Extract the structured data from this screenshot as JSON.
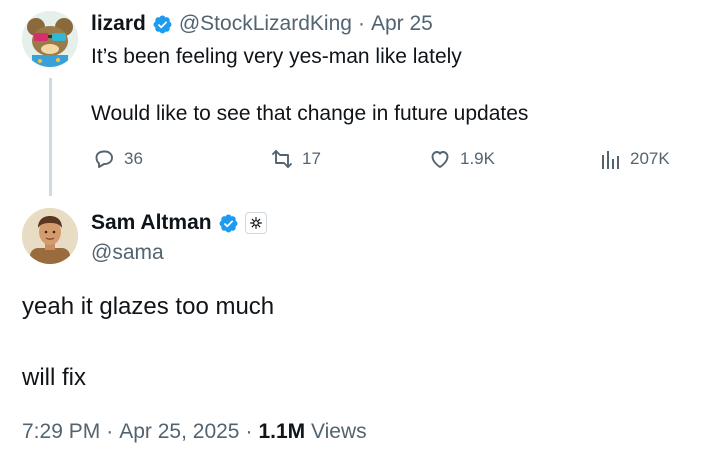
{
  "reply": {
    "avatar": "lizard-avatar",
    "name": "lizard",
    "handle": "@StockLizardKing",
    "separator": "·",
    "date": "Apr 25",
    "line1": "It’s been feeling very yes-man like lately",
    "line2": "Would like to see that change in future updates",
    "actions": {
      "replies": "36",
      "reposts": "17",
      "likes": "1.9K",
      "views": "207K"
    }
  },
  "main": {
    "avatar": "sam-avatar",
    "name": "Sam Altman",
    "handle": "@sama",
    "line1": "yeah it glazes too much",
    "line2": "will fix",
    "time": "7:29 PM",
    "sep1": "·",
    "date": "Apr 25, 2025",
    "sep2": "·",
    "views_count": "1.1M",
    "views_label": "Views"
  },
  "colors": {
    "verified": "#1d9bf0",
    "muted": "#536471",
    "thread_line": "#cfd9de"
  }
}
